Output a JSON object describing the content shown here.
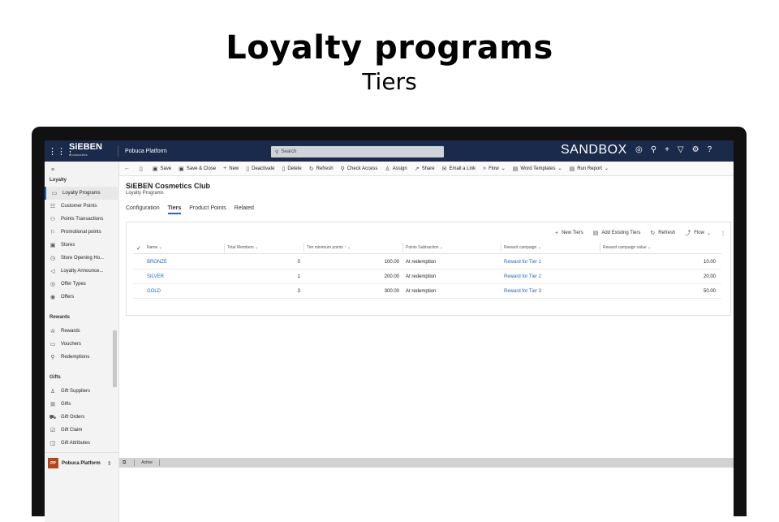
{
  "heading": {
    "title": "Loyalty programs",
    "subtitle": "Tiers"
  },
  "topbar": {
    "brand": "SiEBEN",
    "brand_sub": "a pobucuites",
    "app_name": "Pobuca Platform",
    "search_placeholder": "Search",
    "environment": "SANDBOX"
  },
  "sidebar": {
    "section_main": "Loyalty",
    "main_items": [
      {
        "label": "Loyalty Programs",
        "icon": "program-icon"
      },
      {
        "label": "Customer Points",
        "icon": "points-icon"
      },
      {
        "label": "Points Transactions",
        "icon": "transactions-icon"
      },
      {
        "label": "Promotional points",
        "icon": "promo-icon"
      },
      {
        "label": "Stores",
        "icon": "store-icon"
      },
      {
        "label": "Store Opening Ho...",
        "icon": "clock-icon"
      },
      {
        "label": "Loyalty Announce...",
        "icon": "announce-icon"
      },
      {
        "label": "Offer Types",
        "icon": "offer-type-icon"
      },
      {
        "label": "Offers",
        "icon": "offers-icon"
      }
    ],
    "section_rewards": "Rewards",
    "reward_items": [
      {
        "label": "Rewards",
        "icon": "reward-icon"
      },
      {
        "label": "Vouchers",
        "icon": "voucher-icon"
      },
      {
        "label": "Redemptions",
        "icon": "redemption-icon"
      }
    ],
    "section_gifts": "Gifts",
    "gift_items": [
      {
        "label": "Gift Suppliers",
        "icon": "supplier-icon"
      },
      {
        "label": "Gifts",
        "icon": "gift-icon"
      },
      {
        "label": "Gift Orders",
        "icon": "order-icon"
      },
      {
        "label": "Gift Claim",
        "icon": "claim-icon"
      },
      {
        "label": "Gift Attributes",
        "icon": "attributes-icon"
      }
    ],
    "area_badge": "PP",
    "area_label": "Pobuca Platform"
  },
  "commands": [
    "Save",
    "Save & Close",
    "New",
    "Deactivate",
    "Delete",
    "Refresh",
    "Check Access",
    "Assign",
    "Share",
    "Email a Link",
    "Flow",
    "Word Templates",
    "Run Report"
  ],
  "record": {
    "title": "SiEBEN Cosmetics Club",
    "entity": "Loyalty Programs"
  },
  "tabs": [
    "Configuration",
    "Tiers",
    "Product Points",
    "Related"
  ],
  "grid": {
    "commands": [
      "New Tiers",
      "Add Existing Tiers",
      "Refresh",
      "Flow"
    ],
    "columns": [
      "Name",
      "Total Members",
      "Tier minimum points",
      "Points Subtraction",
      "Reward campaign",
      "Reward campaign value"
    ],
    "rows": [
      {
        "name": "BRONZE",
        "members": "0",
        "min_points": "100.00",
        "subtraction": "At redemption",
        "campaign": "Reward for Tier 1",
        "value": "10.00"
      },
      {
        "name": "SILVER",
        "members": "1",
        "min_points": "200.00",
        "subtraction": "At redemption",
        "campaign": "Reward for Tier 2",
        "value": "20.00"
      },
      {
        "name": "GOLD",
        "members": "3",
        "min_points": "300.00",
        "subtraction": "At redemption",
        "campaign": "Reward for Tier 3",
        "value": "50.00"
      }
    ]
  },
  "status": {
    "state": "Active"
  }
}
